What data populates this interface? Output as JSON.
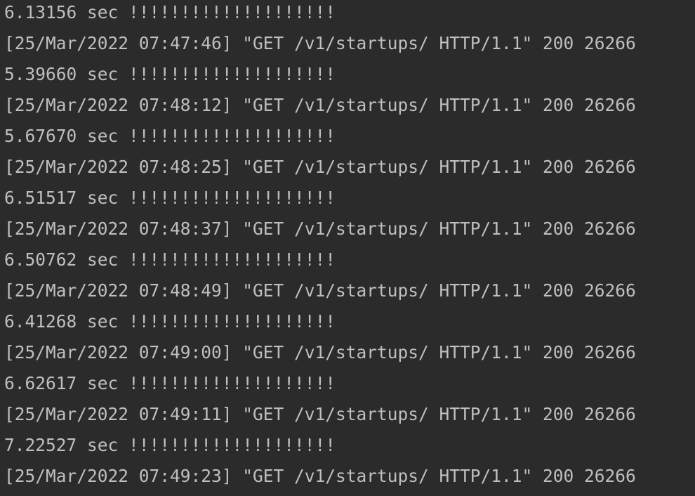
{
  "console": {
    "lines": [
      "6.13156 sec !!!!!!!!!!!!!!!!!!!!",
      "[25/Mar/2022 07:47:46] \"GET /v1/startups/ HTTP/1.1\" 200 26266",
      "5.39660 sec !!!!!!!!!!!!!!!!!!!!",
      "[25/Mar/2022 07:48:12] \"GET /v1/startups/ HTTP/1.1\" 200 26266",
      "5.67670 sec !!!!!!!!!!!!!!!!!!!!",
      "[25/Mar/2022 07:48:25] \"GET /v1/startups/ HTTP/1.1\" 200 26266",
      "6.51517 sec !!!!!!!!!!!!!!!!!!!!",
      "[25/Mar/2022 07:48:37] \"GET /v1/startups/ HTTP/1.1\" 200 26266",
      "6.50762 sec !!!!!!!!!!!!!!!!!!!!",
      "[25/Mar/2022 07:48:49] \"GET /v1/startups/ HTTP/1.1\" 200 26266",
      "6.41268 sec !!!!!!!!!!!!!!!!!!!!",
      "[25/Mar/2022 07:49:00] \"GET /v1/startups/ HTTP/1.1\" 200 26266",
      "6.62617 sec !!!!!!!!!!!!!!!!!!!!",
      "[25/Mar/2022 07:49:11] \"GET /v1/startups/ HTTP/1.1\" 200 26266",
      "7.22527 sec !!!!!!!!!!!!!!!!!!!!",
      "[25/Mar/2022 07:49:23] \"GET /v1/startups/ HTTP/1.1\" 200 26266"
    ]
  },
  "colors": {
    "background": "#2b2b2b",
    "text": "#bfbfbf"
  }
}
